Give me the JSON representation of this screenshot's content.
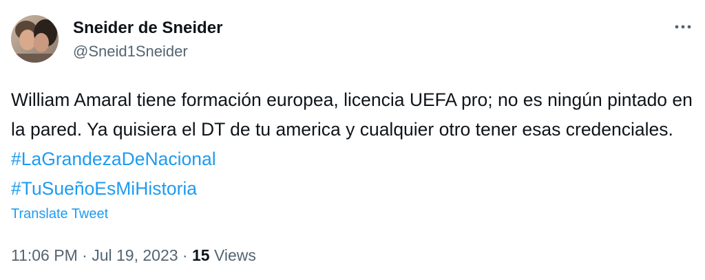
{
  "author": {
    "name": "Sneider de Sneider",
    "handle": "@Sneid1Sneider"
  },
  "more_icon": "more-horizontal-icon",
  "tweet": {
    "text_part1": "William Amaral tiene formación europea, licencia UEFA pro; no es ningún pintado en la pared. Ya quisiera el DT de tu america y cualquier otro tener esas credenciales. ",
    "hashtags": [
      "#LaGrandezaDeNacional",
      "#TuSueñoEsMiHistoria"
    ]
  },
  "translate_label": "Translate Tweet",
  "meta": {
    "time": "11:06 PM",
    "separator1": " · ",
    "date": "Jul 19, 2023",
    "separator2": " · ",
    "views_count": "15",
    "views_label": " Views"
  },
  "colors": {
    "link": "#1d9bf0",
    "secondary": "#536471",
    "primary": "#0f1419"
  }
}
